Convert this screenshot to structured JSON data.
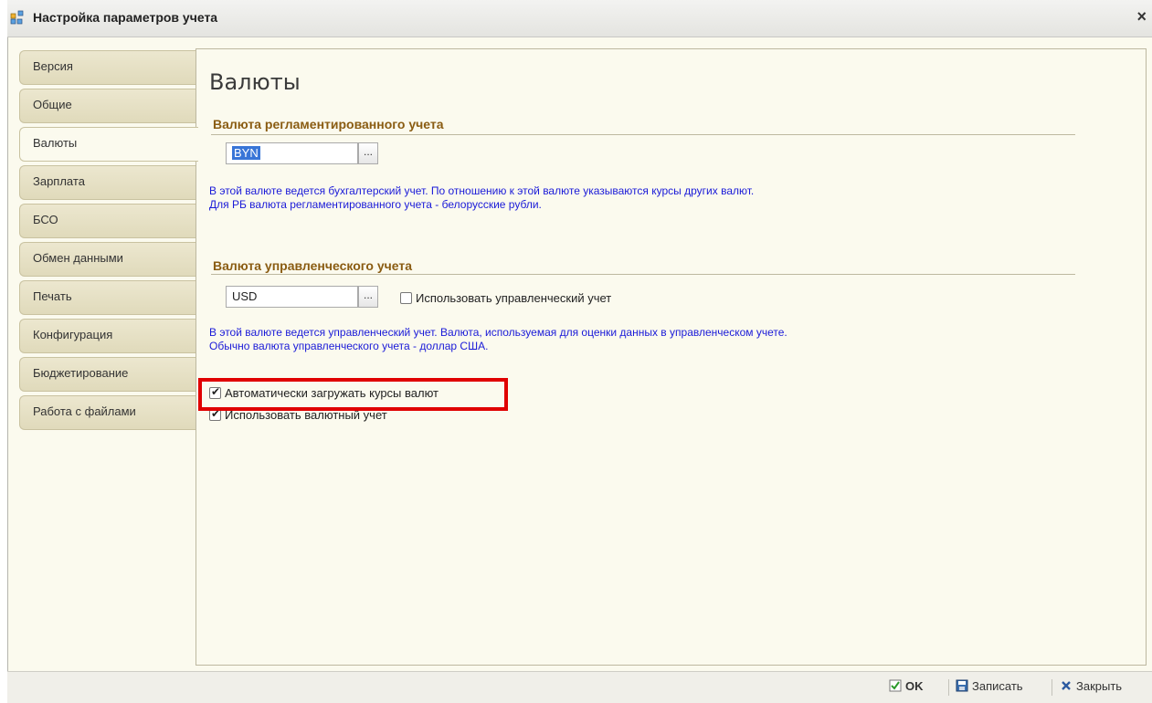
{
  "window": {
    "title": "Настройка параметров учета",
    "close_icon": "×"
  },
  "tabs": [
    {
      "label": "Версия"
    },
    {
      "label": "Общие"
    },
    {
      "label": "Валюты"
    },
    {
      "label": "Зарплата"
    },
    {
      "label": "БСО"
    },
    {
      "label": "Обмен данными"
    },
    {
      "label": "Печать"
    },
    {
      "label": "Конфигурация"
    },
    {
      "label": "Бюджетирование"
    },
    {
      "label": "Работа с файлами"
    }
  ],
  "active_tab": "Валюты",
  "panel": {
    "title": "Валюты",
    "reg_section": {
      "heading": "Валюта регламентированного учета",
      "value": "BYN",
      "pick_label": "...",
      "note_line1": "В этой валюте ведется бухгалтерский учет. По отношению к этой валюте указываются курсы других валют.",
      "note_line2": "Для РБ валюта регламентированного учета - белорусские рубли."
    },
    "mgmt_section": {
      "heading": "Валюта управленческого учета",
      "value": "USD",
      "pick_label": "...",
      "checkbox_label": "Использовать управленческий учет",
      "checkbox_checked": false,
      "note_line1": "В этой валюте ведется управленческий учет. Валюта, используемая для оценки данных в управленческом учете.",
      "note_line2": "Обычно валюта управленческого учета - доллар США."
    },
    "auto_rates": {
      "label": "Автоматически загружать курсы валют",
      "checked": true
    },
    "currency_accounting": {
      "label": "Использовать валютный учет",
      "checked": true
    }
  },
  "bottom": {
    "ok": "OK",
    "save": "Записать",
    "close": "Закрыть"
  },
  "colors": {
    "highlight": "#e00000",
    "note_text": "#1a1ad8",
    "section_heading": "#8a5c12"
  }
}
